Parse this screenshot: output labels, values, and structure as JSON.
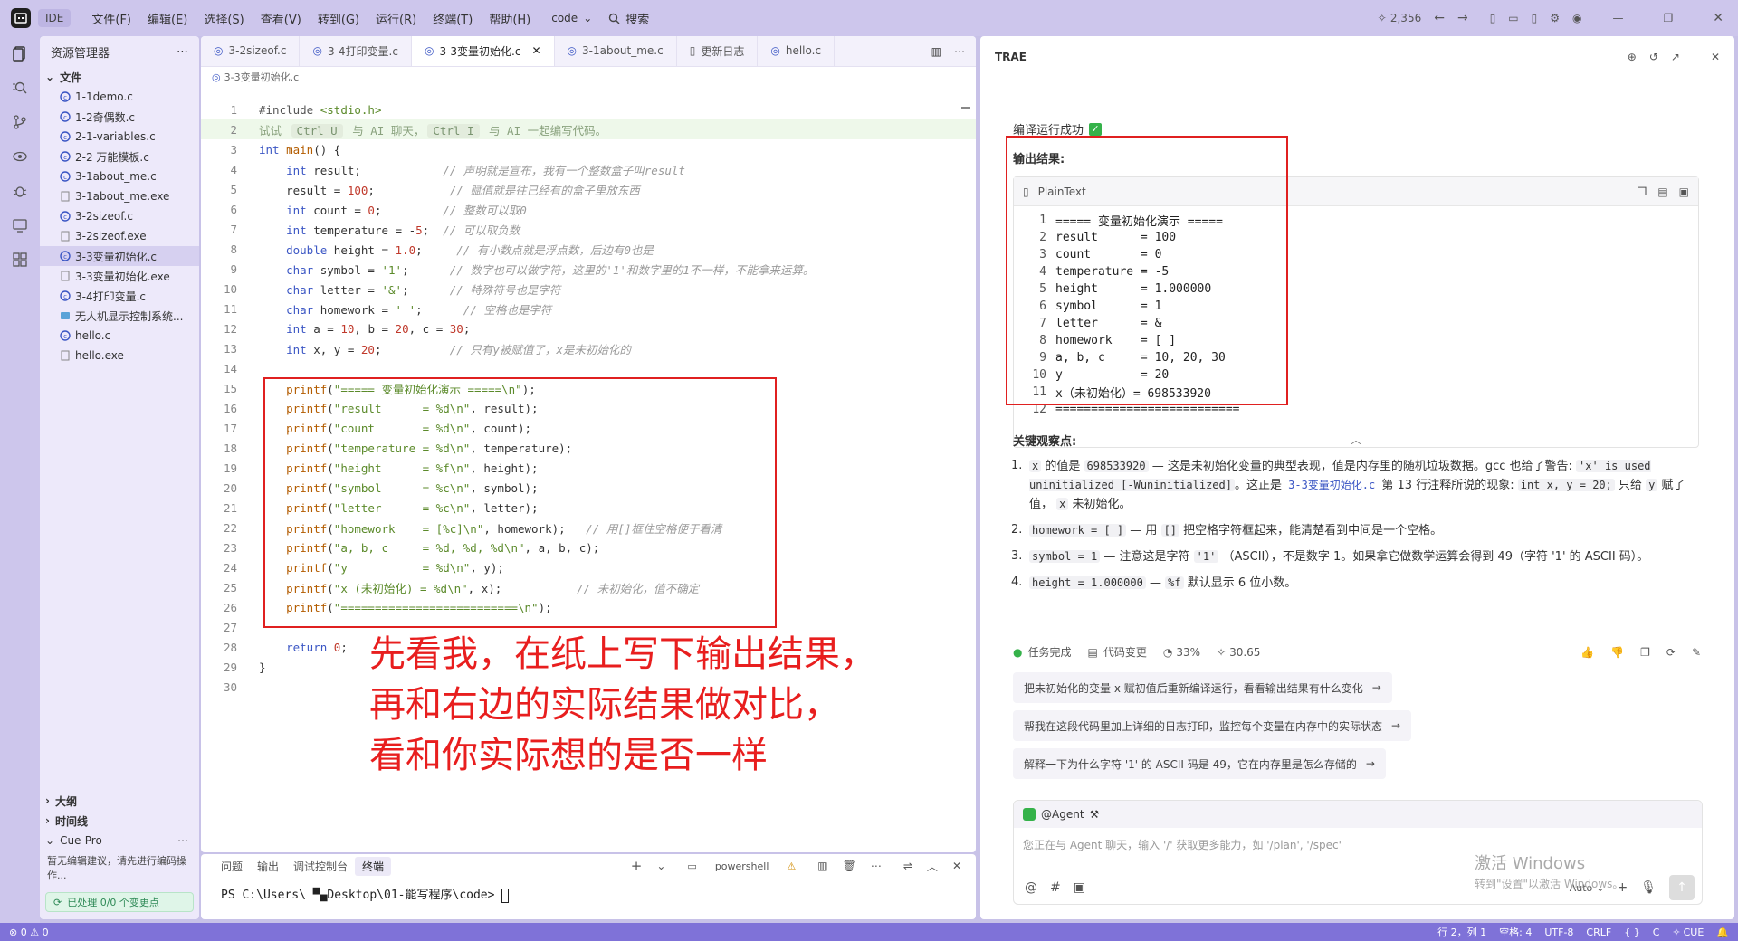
{
  "titlebar": {
    "ide_label": "IDE",
    "menu": [
      "文件(F)",
      "编辑(E)",
      "选择(S)",
      "查看(V)",
      "转到(G)",
      "运行(R)",
      "终端(T)",
      "帮助(H)"
    ],
    "workspace": "code",
    "search": "搜索",
    "count": "2,356"
  },
  "explorer": {
    "title": "资源管理器",
    "section": "文件",
    "files": [
      "1-1demo.c",
      "1-2奇偶数.c",
      "2-1-variables.c",
      "2-2 万能模板.c",
      "3-1about_me.c",
      "3-1about_me.exe",
      "3-2sizeof.c",
      "3-2sizeof.exe",
      "3-3变量初始化.c",
      "3-3变量初始化.exe",
      "3-4打印变量.c",
      "无人机显示控制系统...",
      "hello.c",
      "hello.exe"
    ],
    "selected_index": 8,
    "outline": "大纲",
    "timeline": "时间线",
    "cue_title": "Cue-Pro",
    "cue_text": "暂无编辑建议，请先进行编码操作...",
    "processed": "已处理 0/0 个变更点"
  },
  "editor": {
    "tabs": [
      "3-2sizeof.c",
      "3-4打印变量.c",
      "3-3变量初始化.c",
      "3-1about_me.c",
      "更新日志",
      "hello.c"
    ],
    "active_tab": 2,
    "breadcrumb": "3-3变量初始化.c",
    "hint_try": "试试",
    "hint_key1": "Ctrl U",
    "hint_mid": "与 AI 聊天，",
    "hint_key2": "Ctrl I",
    "hint_end": "与 AI 一起编写代码。"
  },
  "terminal": {
    "tabs": [
      "问题",
      "输出",
      "调试控制台",
      "终端"
    ],
    "active": 3,
    "shell": "powershell",
    "prompt": "PS C:\\Users\\ ▀▄Desktop\\01-能写程序\\code> "
  },
  "annotation": {
    "line1": "先看我，在纸上写下输出结果，",
    "line2": "再和右边的实际结果做对比，",
    "line3": "看和你实际想的是否一样"
  },
  "ai": {
    "brand": "TRAE",
    "status": "编译运行成功",
    "output_title": "输出结果:",
    "block_lang": "PlainText",
    "output_lines": [
      "===== 变量初始化演示 =====",
      "result      = 100",
      "count       = 0",
      "temperature = -5",
      "height      = 1.000000",
      "symbol      = 1",
      "letter      = &",
      "homework    = [ ]",
      "a, b, c     = 10, 20, 30",
      "y           = 20",
      "x（未初始化）= 698533920",
      "=========================="
    ],
    "observe_title": "关键观察点:",
    "obs1_a": "x",
    "obs1_b": "的值是",
    "obs1_c": "698533920",
    "obs1_d": "— 这是未初始化变量的典型表现，值是内存里的随机垃圾数据。gcc 也给了警告:",
    "obs1_e": "'x' is used uninitialized [-Wuninitialized]",
    "obs1_f": "。这正是",
    "obs1_g": "3-3变量初始化.c",
    "obs1_h": "第 13 行注释所说的现象:",
    "obs1_i": "int x, y = 20;",
    "obs1_j": "只给",
    "obs1_k": "y",
    "obs1_l": "赋了值，",
    "obs1_m": "x",
    "obs1_n": "未初始化。",
    "obs2_a": "homework = [ ]",
    "obs2_b": "— 用",
    "obs2_c": "[]",
    "obs2_d": "把空格字符框起来，能清楚看到中间是一个空格。",
    "obs3_a": "symbol = 1",
    "obs3_b": "— 注意这是字符",
    "obs3_c": "'1'",
    "obs3_d": "（ASCII），不是数字 1。如果拿它做数学运算会得到 49（字符 '1' 的 ASCII 码）。",
    "obs4_a": "height = 1.000000",
    "obs4_b": "—",
    "obs4_c": "%f",
    "obs4_d": "默认显示 6 位小数。",
    "task_done": "任务完成",
    "code_change": "代码变更",
    "percent": "33%",
    "points": "30.65",
    "suggestions": [
      "把未初始化的变量 x 赋初值后重新编译运行，看看输出结果有什么变化",
      "帮我在这段代码里加上详细的日志打印，监控每个变量在内存中的实际状态",
      "解释一下为什么字符 '1' 的 ASCII 码是 49，它在内存里是怎么存储的"
    ],
    "agent": "@Agent",
    "input_placeholder": "您正在与 Agent 聊天，输入 '/' 获取更多能力，如 '/plan', '/spec'",
    "auto": "Auto",
    "win_activate": "激活 Windows",
    "win_activate_sub": "转到\"设置\"以激活 Windows。"
  },
  "status": {
    "left": "⊗ 0 ⚠ 0",
    "pos": "行 2，列 1",
    "spaces": "空格: 4",
    "enc": "UTF-8",
    "eol": "CRLF",
    "braces": "{ }",
    "lang": "C",
    "cue": "CUE"
  }
}
